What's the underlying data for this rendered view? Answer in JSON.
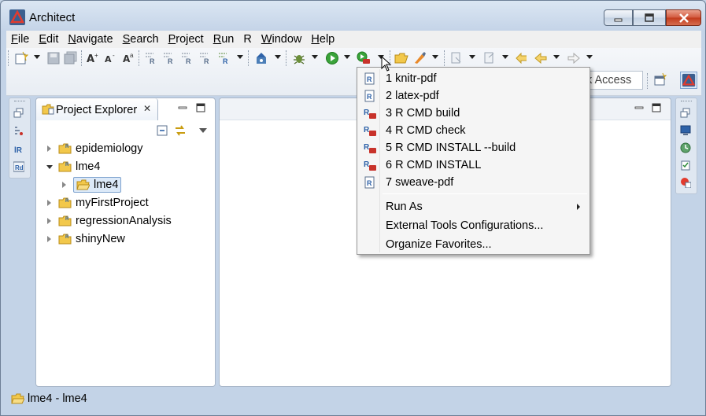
{
  "window": {
    "title": "Architect"
  },
  "menubar": {
    "items": [
      {
        "label": "File",
        "mnemonic": "F",
        "rest": "ile"
      },
      {
        "label": "Edit",
        "mnemonic": "E",
        "rest": "dit"
      },
      {
        "label": "Navigate",
        "mnemonic": "N",
        "rest": "avigate"
      },
      {
        "label": "Search",
        "mnemonic": "S",
        "rest": "earch"
      },
      {
        "label": "Project",
        "mnemonic": "P",
        "rest": "roject"
      },
      {
        "label": "Run",
        "mnemonic": "R",
        "rest": "un"
      },
      {
        "label": "R",
        "mnemonic": "",
        "rest": "R"
      },
      {
        "label": "Window",
        "mnemonic": "W",
        "rest": "indow"
      },
      {
        "label": "Help",
        "mnemonic": "H",
        "rest": "elp"
      }
    ]
  },
  "toolbar": {
    "quick_access_text": "k Access"
  },
  "explorer": {
    "tab_label": "Project Explorer",
    "tab_close": "✕",
    "tree": [
      {
        "label": "epidemiology",
        "expanded": false,
        "level": 0
      },
      {
        "label": "lme4",
        "expanded": true,
        "level": 0
      },
      {
        "label": "lme4",
        "expanded": false,
        "level": 1,
        "selected": true
      },
      {
        "label": "myFirstProject",
        "expanded": false,
        "level": 0
      },
      {
        "label": "regressionAnalysis",
        "expanded": false,
        "level": 0
      },
      {
        "label": "shinyNew",
        "expanded": false,
        "level": 0
      }
    ]
  },
  "dropdown": {
    "items": [
      {
        "label": "1 knitr-pdf",
        "icon": "rnw-file-icon"
      },
      {
        "label": "2 latex-pdf",
        "icon": "rnw-file-icon"
      },
      {
        "label": "3 R CMD build",
        "icon": "r-package-icon"
      },
      {
        "label": "4 R CMD check",
        "icon": "r-package-icon"
      },
      {
        "label": "5 R CMD INSTALL --build",
        "icon": "r-package-icon"
      },
      {
        "label": "6 R CMD INSTALL",
        "icon": "r-package-icon"
      },
      {
        "label": "7 sweave-pdf",
        "icon": "rnw-file-icon"
      }
    ],
    "run_as": "Run As",
    "external_tools": "External Tools Configurations...",
    "organize_favorites": "Organize Favorites..."
  },
  "statusbar": {
    "text": "lme4 - lme4"
  },
  "colors": {
    "accent_red": "#c8322a",
    "selection_bg": "#dce9f8",
    "folder_yellow": "#f2c84b"
  }
}
